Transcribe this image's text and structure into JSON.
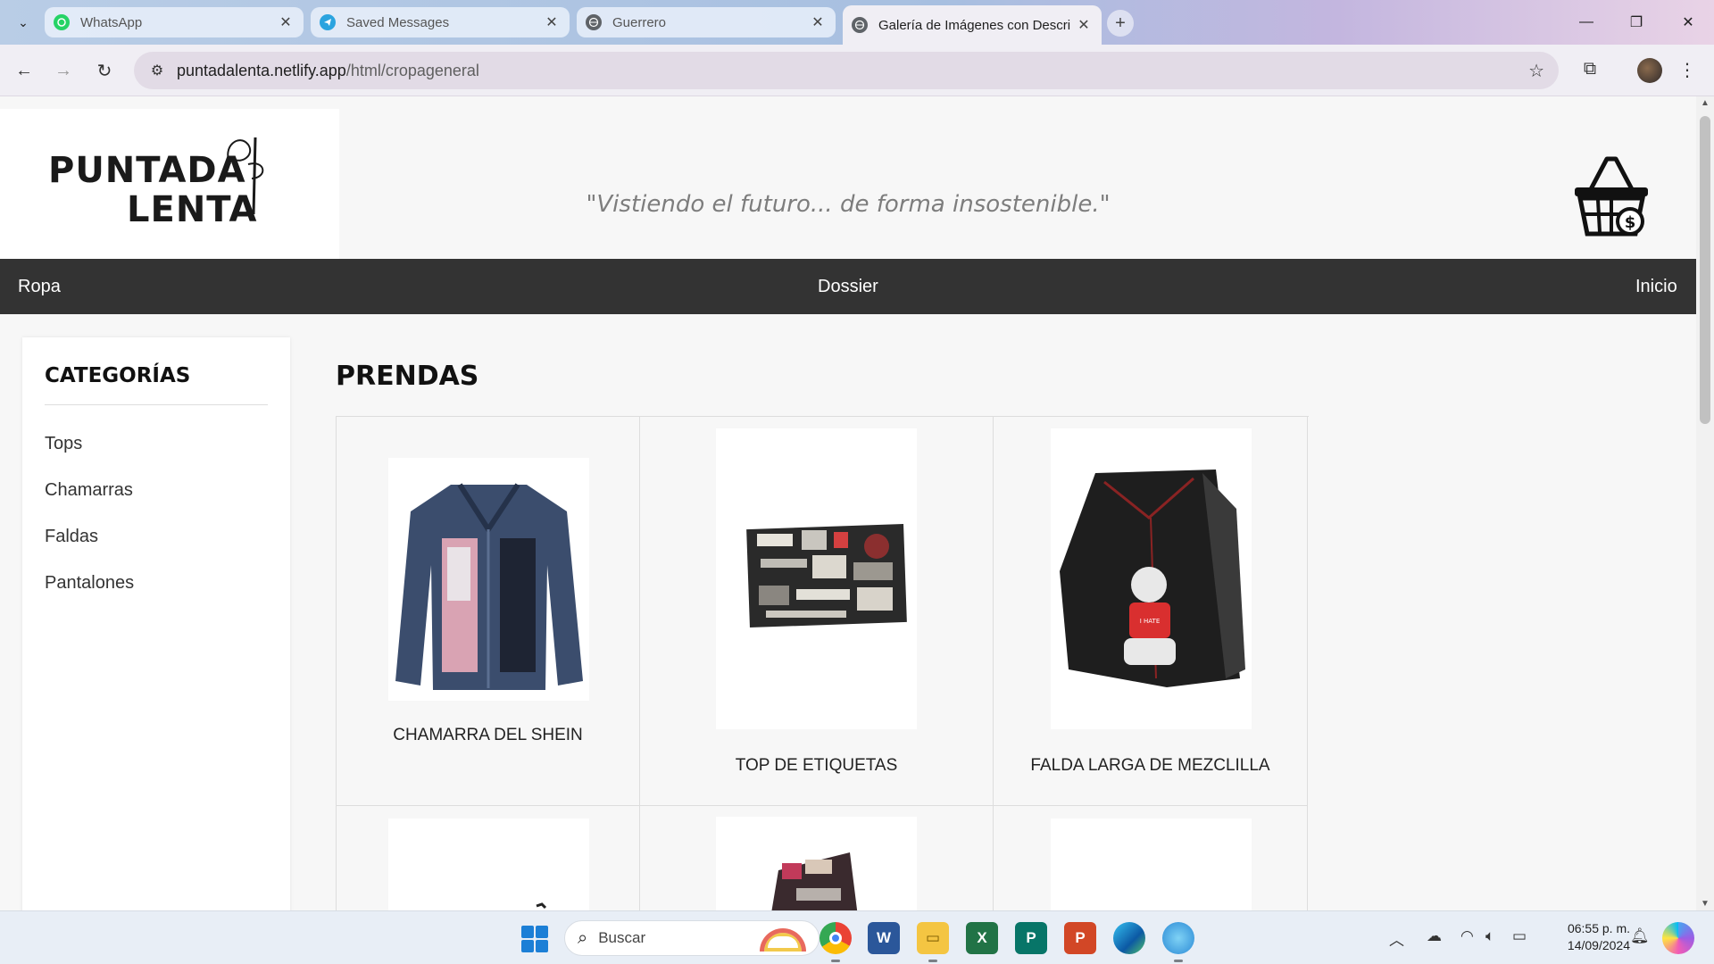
{
  "browser": {
    "tabs": [
      {
        "title": "WhatsApp",
        "icon": "whatsapp-icon",
        "color": "#25d366"
      },
      {
        "title": "Saved Messages",
        "icon": "telegram-icon",
        "color": "#2aa3df"
      },
      {
        "title": "Guerrero",
        "icon": "globe-icon",
        "color": "#5f6368"
      },
      {
        "title": "Galería de Imágenes con Descri",
        "icon": "globe-icon",
        "color": "#5f6368"
      }
    ],
    "url_host": "puntadalenta.netlify.app",
    "url_path": "/html/cropageneral"
  },
  "header": {
    "logo_line1": "PUNTADA",
    "logo_line2": "LENTA",
    "slogan": "\"Vistiendo el futuro... de forma insostenible.\"",
    "cart_icon": "shopping-basket-dollar-icon"
  },
  "nav": {
    "left": "Ropa",
    "center": "Dossier",
    "right": "Inicio"
  },
  "sidebar": {
    "title": "CATEGORÍAS",
    "items": [
      "Tops",
      "Chamarras",
      "Faldas",
      "Pantalones"
    ]
  },
  "main": {
    "title": "PRENDAS",
    "products": [
      {
        "name": "CHAMARRA DEL SHEIN",
        "image": "denim-jacket-photo"
      },
      {
        "name": "TOP DE ETIQUETAS",
        "image": "label-patchwork-top-photo"
      },
      {
        "name": "FALDA LARGA DE MEZCLILLA",
        "image": "black-denim-skirt-photo"
      }
    ]
  },
  "taskbar": {
    "search_placeholder": "Buscar",
    "time": "06:55 p. m.",
    "date": "14/09/2024"
  },
  "colors": {
    "nav_bg": "#333333",
    "page_bg": "#f7f7f7",
    "accent_red": "#e03a3e"
  }
}
